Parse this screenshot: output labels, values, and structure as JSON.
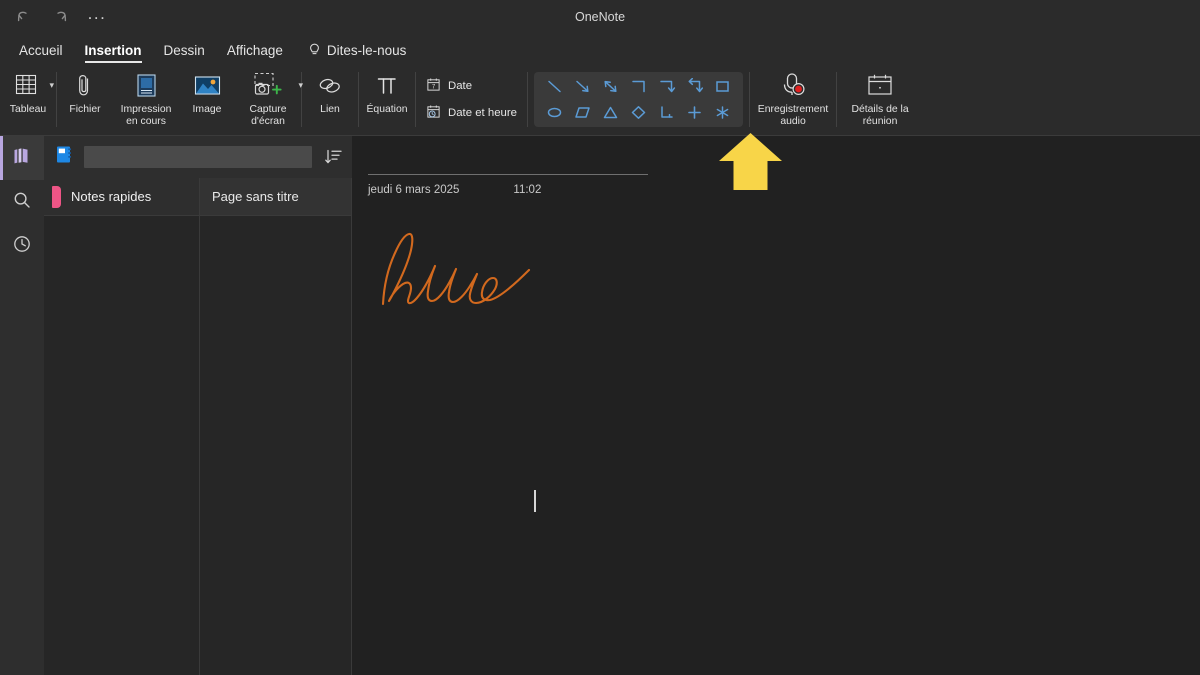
{
  "window": {
    "app_title": "OneNote",
    "quick_access": [
      {
        "name": "undo",
        "label": "Annuler"
      },
      {
        "name": "redo",
        "label": "Rétablir"
      },
      {
        "name": "more",
        "label": "..."
      }
    ]
  },
  "ribbon": {
    "tabs": [
      {
        "label": "Accueil",
        "active": false
      },
      {
        "label": "Insertion",
        "active": true
      },
      {
        "label": "Dessin",
        "active": false
      },
      {
        "label": "Affichage",
        "active": false
      }
    ],
    "tell_me": "Dites-le-nous",
    "groups": {
      "table": {
        "label": "Tableau",
        "icon": "table-icon",
        "has_dropdown": true
      },
      "file": {
        "label": "Fichier",
        "icon": "paperclip-icon"
      },
      "printout": {
        "label": "Impression en cours",
        "icon": "printout-icon"
      },
      "image": {
        "label": "Image",
        "icon": "picture-icon"
      },
      "screen_clipping": {
        "label": "Capture d'écran",
        "icon": "camera-clip-icon",
        "has_dropdown": true
      },
      "link": {
        "label": "Lien",
        "icon": "link-icon"
      },
      "equation": {
        "label": "Équation",
        "icon": "pi-icon"
      },
      "date": {
        "label": "Date",
        "icon": "calendar-icon"
      },
      "date_time": {
        "label": "Date et heure",
        "icon": "calendar-clock-icon"
      },
      "audio_recording": {
        "label": "Enregistrement audio",
        "icon": "audio-record-icon"
      },
      "meeting_details": {
        "label": "Détails de la réunion",
        "icon": "meeting-calendar-icon"
      }
    },
    "shapes_gallery": {
      "row1": [
        "line",
        "arrow",
        "double-arrow",
        "elbow",
        "elbow-arrow",
        "elbow-double-arrow",
        "rectangle"
      ],
      "row2": [
        "ellipse",
        "parallelogram",
        "triangle",
        "diamond",
        "bracket",
        "plus",
        "asterisk"
      ],
      "accent_color": "#5b9bd5"
    }
  },
  "rail": {
    "items": [
      {
        "name": "notebooks",
        "icon": "notebooks-icon",
        "active": true
      },
      {
        "name": "search",
        "icon": "search-icon",
        "active": false
      },
      {
        "name": "recent",
        "icon": "clock-icon",
        "active": false
      }
    ]
  },
  "navigation": {
    "notebook_icon": "notebook-icon",
    "notebook_name": "",
    "sort_icon": "sort-icon",
    "sections": [
      {
        "label": "Notes rapides",
        "color": "#ee5586",
        "selected": true
      }
    ],
    "pages": [
      {
        "label": "Page sans titre",
        "selected": true
      }
    ]
  },
  "canvas": {
    "page_title": "",
    "date": "jeudi 6 mars 2025",
    "time": "11:02",
    "ink_note": "hello",
    "ink_color": "#d2691e"
  },
  "annotation": {
    "type": "arrow-up",
    "color": "#f8d548",
    "points_at": "Enregistrement audio"
  }
}
